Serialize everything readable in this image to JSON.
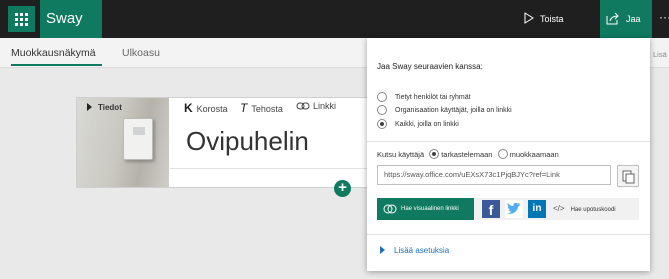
{
  "app": {
    "name": "Sway",
    "accent_color": "#0f7a5f"
  },
  "topbar": {
    "play_label": "Toista",
    "share_label": "Jaa",
    "more_label": "···"
  },
  "tabs": {
    "edit": "Muokkausnäkymä",
    "design": "Ulkoasu",
    "right_partial": "Lisä"
  },
  "card": {
    "details_label": "Tiedot",
    "format_buttons": [
      {
        "icon": "K",
        "label": "Korosta"
      },
      {
        "icon": "T",
        "label": "Tehosta"
      },
      {
        "icon": "link-icon",
        "label": "Linkki"
      }
    ],
    "heading": "Ovipuhelin",
    "add_label": "+"
  },
  "share_panel": {
    "title": "Jaa Sway seuraavien kanssa:",
    "options": [
      {
        "label": "Tietyt henkilöt tai ryhmät",
        "selected": false
      },
      {
        "label": "Organisaation käyttäjät, joilla on linkki",
        "selected": false
      },
      {
        "label": "Kaikki, joilla on linkki",
        "selected": true
      }
    ],
    "invite": {
      "label": "Kutsu käyttäjä",
      "view_label": "tarkastelemaan",
      "edit_label": "muokkaamaan",
      "selected": "view"
    },
    "link_url": "https://sway.office.com/uEXsX73c1PjqBJYc?ref=Link",
    "visual_link_label": "Hae visuaalinen linkki",
    "social": [
      "facebook-icon",
      "twitter-icon",
      "linkedin-icon"
    ],
    "embed_symbol": "</>",
    "embed_label": "Hae upotuskoodi",
    "more_settings_label": "Lisää asetuksia"
  }
}
